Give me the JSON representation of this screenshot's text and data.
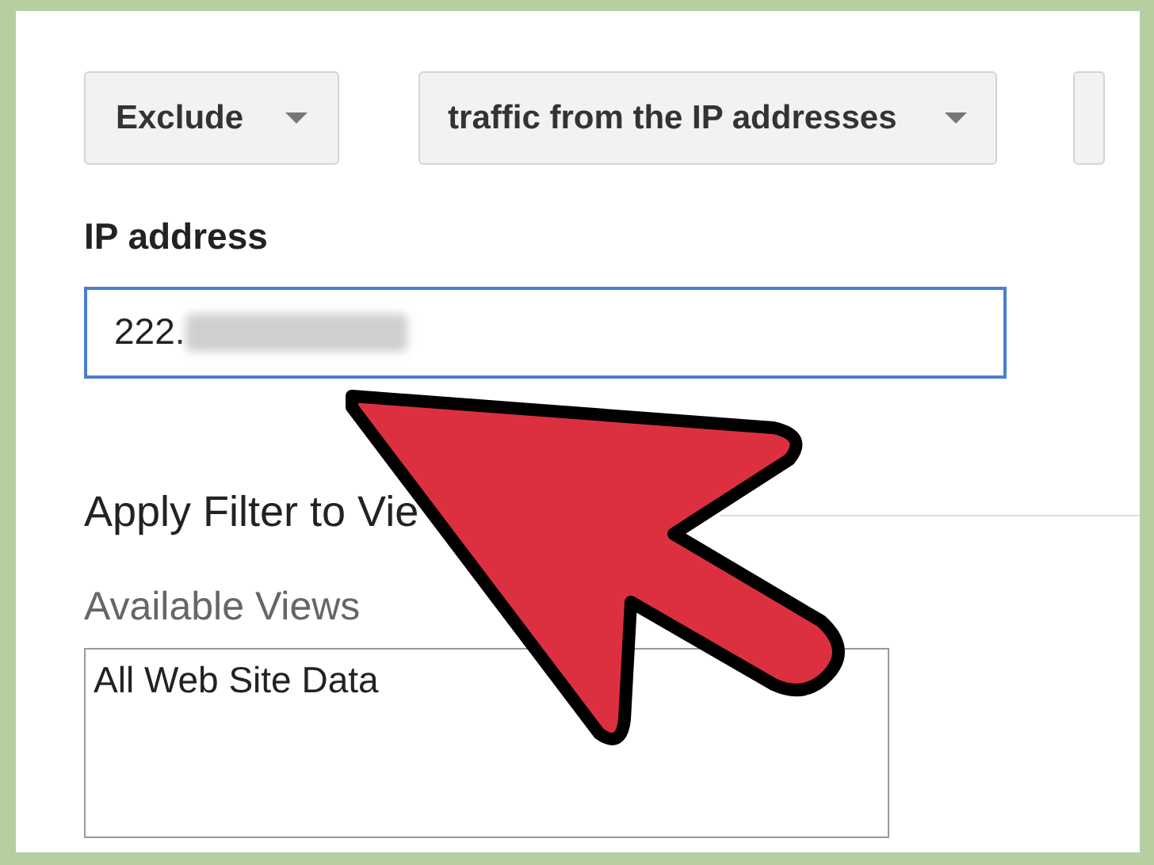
{
  "filter": {
    "type_dropdown": {
      "value": "Exclude"
    },
    "source_dropdown": {
      "value": "traffic from the IP addresses"
    }
  },
  "ip_address": {
    "label": "IP address",
    "value": "222."
  },
  "apply_section": {
    "heading": "Apply Filter to Vie",
    "available_label": "Available Views",
    "views": [
      {
        "label": "All Web Site Data",
        "selected": false
      }
    ]
  }
}
